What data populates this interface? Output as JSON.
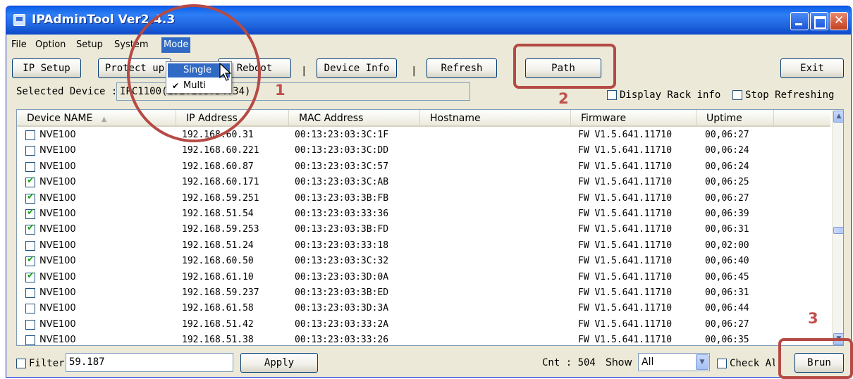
{
  "window": {
    "title": "IPAdminTool Ver2.4.3"
  },
  "menu": {
    "file": "File",
    "option": "Option",
    "setup": "Setup",
    "system": "System",
    "mode": "Mode",
    "mode_items": [
      {
        "label": "Single",
        "checked": false
      },
      {
        "label": "Multi",
        "checked": true
      }
    ]
  },
  "toolbar": {
    "ip_setup": "IP Setup",
    "protect": "Protect up",
    "reboot": "Reboot",
    "device_info": "Device Info",
    "refresh": "Refresh",
    "path": "Path",
    "exit": "Exit",
    "separator": "|"
  },
  "selected_device": {
    "label": "Selected Device :",
    "value": "IPC1100(192.168.54.34)"
  },
  "options": {
    "display_rack_info": "Display Rack info",
    "stop_refreshing": "Stop Refreshing"
  },
  "list": {
    "columns": [
      "Device NAME",
      "IP Address",
      "MAC Address",
      "Hostname",
      "Firmware",
      "Uptime"
    ],
    "sort_indicator": "▲",
    "rows": [
      {
        "checked": false,
        "name": "NVE100",
        "ip": "192.168.60.31",
        "mac": "00:13:23:03:3C:1F",
        "host": "",
        "fw": "FW V1.5.641.11710",
        "up": "00,06:27"
      },
      {
        "checked": false,
        "name": "NVE100",
        "ip": "192.168.60.221",
        "mac": "00:13:23:03:3C:DD",
        "host": "",
        "fw": "FW V1.5.641.11710",
        "up": "00,06:24"
      },
      {
        "checked": false,
        "name": "NVE100",
        "ip": "192.168.60.87",
        "mac": "00:13:23:03:3C:57",
        "host": "",
        "fw": "FW V1.5.641.11710",
        "up": "00,06:24"
      },
      {
        "checked": true,
        "name": "NVE100",
        "ip": "192.168.60.171",
        "mac": "00:13:23:03:3C:AB",
        "host": "",
        "fw": "FW V1.5.641.11710",
        "up": "00,06:25"
      },
      {
        "checked": true,
        "name": "NVE100",
        "ip": "192.168.59.251",
        "mac": "00:13:23:03:3B:FB",
        "host": "",
        "fw": "FW V1.5.641.11710",
        "up": "00,06:27"
      },
      {
        "checked": true,
        "name": "NVE100",
        "ip": "192.168.51.54",
        "mac": "00:13:23:03:33:36",
        "host": "",
        "fw": "FW V1.5.641.11710",
        "up": "00,06:39"
      },
      {
        "checked": true,
        "name": "NVE100",
        "ip": "192.168.59.253",
        "mac": "00:13:23:03:3B:FD",
        "host": "",
        "fw": "FW V1.5.641.11710",
        "up": "00,06:31"
      },
      {
        "checked": false,
        "name": "NVE100",
        "ip": "192.168.51.24",
        "mac": "00:13:23:03:33:18",
        "host": "",
        "fw": "FW V1.5.641.11710",
        "up": "00,02:00"
      },
      {
        "checked": true,
        "name": "NVE100",
        "ip": "192.168.60.50",
        "mac": "00:13:23:03:3C:32",
        "host": "",
        "fw": "FW V1.5.641.11710",
        "up": "00,06:40"
      },
      {
        "checked": true,
        "name": "NVE100",
        "ip": "192.168.61.10",
        "mac": "00:13:23:03:3D:0A",
        "host": "",
        "fw": "FW V1.5.641.11710",
        "up": "00,06:45"
      },
      {
        "checked": false,
        "name": "NVE100",
        "ip": "192.168.59.237",
        "mac": "00:13:23:03:3B:ED",
        "host": "",
        "fw": "FW V1.5.641.11710",
        "up": "00,06:31"
      },
      {
        "checked": false,
        "name": "NVE100",
        "ip": "192.168.61.58",
        "mac": "00:13:23:03:3D:3A",
        "host": "",
        "fw": "FW V1.5.641.11710",
        "up": "00,06:44"
      },
      {
        "checked": false,
        "name": "NVE100",
        "ip": "192.168.51.42",
        "mac": "00:13:23:03:33:2A",
        "host": "",
        "fw": "FW V1.5.641.11710",
        "up": "00,06:27"
      },
      {
        "checked": false,
        "name": "NVE100",
        "ip": "192.168.51.38",
        "mac": "00:13:23:03:33:26",
        "host": "",
        "fw": "FW V1.5.641.11710",
        "up": "00,06:35"
      }
    ]
  },
  "bottom": {
    "filter_label": "Filter",
    "filter_value": "59.187",
    "apply": "Apply",
    "cnt": "Cnt : 504",
    "show_label": "Show",
    "show_value": "All",
    "check_all": "Check All",
    "brun": "Brun"
  },
  "annotations": [
    "1",
    "2",
    "3"
  ],
  "colors": {
    "title_bar": "#0a5fe8",
    "menu_highlight": "#316ac5",
    "annotation": "#b54a45",
    "check": "#21a121"
  }
}
